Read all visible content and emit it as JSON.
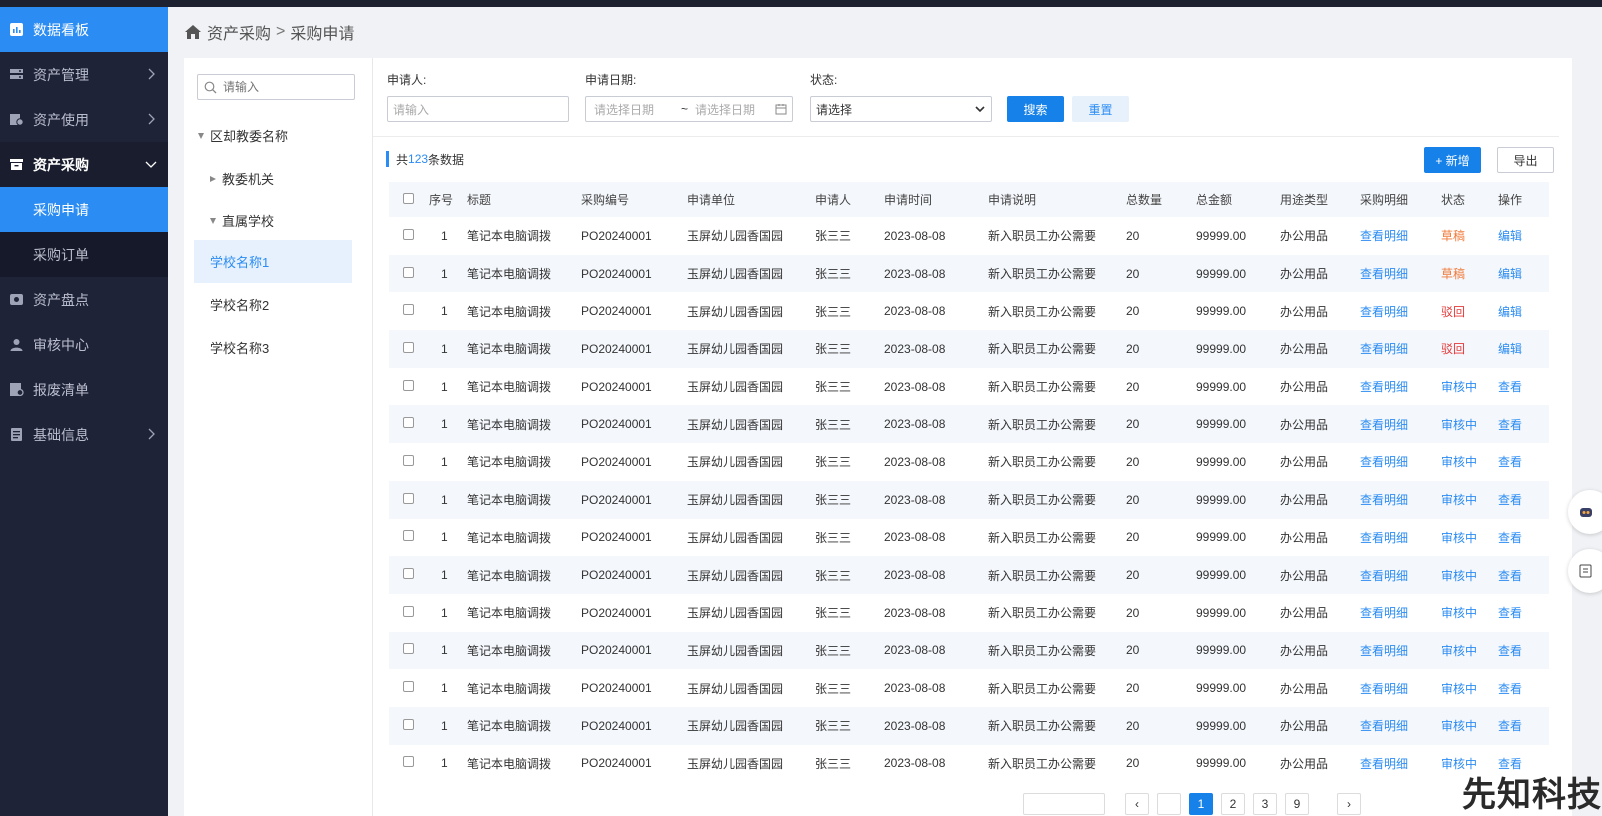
{
  "sidebar": {
    "items": [
      {
        "label": "数据看板",
        "icon": "chart-icon"
      },
      {
        "label": "资产管理",
        "icon": "server-icon"
      },
      {
        "label": "资产使用",
        "icon": "usage-icon"
      },
      {
        "label": "资产采购",
        "icon": "archive-icon"
      },
      {
        "label": "采购申请"
      },
      {
        "label": "采购订单"
      },
      {
        "label": "资产盘点",
        "icon": "inventory-icon"
      },
      {
        "label": "审核中心",
        "icon": "user-icon"
      },
      {
        "label": "报废清单",
        "icon": "scrap-icon"
      },
      {
        "label": "基础信息",
        "icon": "doc-icon"
      }
    ]
  },
  "breadcrumb": {
    "parent": "资产采购",
    "separator": ">",
    "current": "采购申请"
  },
  "tree": {
    "search_placeholder": "请输入",
    "root": "区却教委名称",
    "children": [
      "教委机关",
      "直属学校"
    ],
    "schools": [
      "学校名称1",
      "学校名称2",
      "学校名称3"
    ]
  },
  "filters": {
    "applicant_label": "申请人:",
    "applicant_placeholder": "请输入",
    "date_label": "申请日期:",
    "date_start_placeholder": "请选择日期",
    "date_sep": "~",
    "date_end_placeholder": "请选择日期",
    "status_label": "状态:",
    "status_value": "请选择",
    "search_button": "搜索",
    "reset_button": "重置"
  },
  "summary": {
    "prefix": "共",
    "count": "123",
    "suffix": "条数据"
  },
  "actions": {
    "add_button": "+ 新增",
    "export_button": "导出"
  },
  "table": {
    "columns": [
      "序号",
      "标题",
      "采购编号",
      "申请单位",
      "申请人",
      "申请时间",
      "申请说明",
      "总数量",
      "总金额",
      "用途类型",
      "采购明细",
      "状态",
      "操作"
    ],
    "rows": [
      {
        "no": "1",
        "title": "笔记本电脑调拨",
        "code": "PO20240001",
        "unit": "玉屏幼儿园香国园",
        "applicant": "张三三",
        "time": "2023-08-08",
        "desc": "新入职员工办公需要",
        "qty": "20",
        "amount": "99999.00",
        "usage": "办公用品",
        "detail": "查看明细",
        "status": "草稿",
        "status_type": "draft",
        "op": "编辑"
      },
      {
        "no": "1",
        "title": "笔记本电脑调拨",
        "code": "PO20240001",
        "unit": "玉屏幼儿园香国园",
        "applicant": "张三三",
        "time": "2023-08-08",
        "desc": "新入职员工办公需要",
        "qty": "20",
        "amount": "99999.00",
        "usage": "办公用品",
        "detail": "查看明细",
        "status": "草稿",
        "status_type": "draft",
        "op": "编辑"
      },
      {
        "no": "1",
        "title": "笔记本电脑调拨",
        "code": "PO20240001",
        "unit": "玉屏幼儿园香国园",
        "applicant": "张三三",
        "time": "2023-08-08",
        "desc": "新入职员工办公需要",
        "qty": "20",
        "amount": "99999.00",
        "usage": "办公用品",
        "detail": "查看明细",
        "status": "驳回",
        "status_type": "reject",
        "op": "编辑"
      },
      {
        "no": "1",
        "title": "笔记本电脑调拨",
        "code": "PO20240001",
        "unit": "玉屏幼儿园香国园",
        "applicant": "张三三",
        "time": "2023-08-08",
        "desc": "新入职员工办公需要",
        "qty": "20",
        "amount": "99999.00",
        "usage": "办公用品",
        "detail": "查看明细",
        "status": "驳回",
        "status_type": "reject",
        "op": "编辑"
      },
      {
        "no": "1",
        "title": "笔记本电脑调拨",
        "code": "PO20240001",
        "unit": "玉屏幼儿园香国园",
        "applicant": "张三三",
        "time": "2023-08-08",
        "desc": "新入职员工办公需要",
        "qty": "20",
        "amount": "99999.00",
        "usage": "办公用品",
        "detail": "查看明细",
        "status": "审核中",
        "status_type": "review",
        "op": "查看"
      },
      {
        "no": "1",
        "title": "笔记本电脑调拨",
        "code": "PO20240001",
        "unit": "玉屏幼儿园香国园",
        "applicant": "张三三",
        "time": "2023-08-08",
        "desc": "新入职员工办公需要",
        "qty": "20",
        "amount": "99999.00",
        "usage": "办公用品",
        "detail": "查看明细",
        "status": "审核中",
        "status_type": "review",
        "op": "查看"
      },
      {
        "no": "1",
        "title": "笔记本电脑调拨",
        "code": "PO20240001",
        "unit": "玉屏幼儿园香国园",
        "applicant": "张三三",
        "time": "2023-08-08",
        "desc": "新入职员工办公需要",
        "qty": "20",
        "amount": "99999.00",
        "usage": "办公用品",
        "detail": "查看明细",
        "status": "审核中",
        "status_type": "review",
        "op": "查看"
      },
      {
        "no": "1",
        "title": "笔记本电脑调拨",
        "code": "PO20240001",
        "unit": "玉屏幼儿园香国园",
        "applicant": "张三三",
        "time": "2023-08-08",
        "desc": "新入职员工办公需要",
        "qty": "20",
        "amount": "99999.00",
        "usage": "办公用品",
        "detail": "查看明细",
        "status": "审核中",
        "status_type": "review",
        "op": "查看"
      },
      {
        "no": "1",
        "title": "笔记本电脑调拨",
        "code": "PO20240001",
        "unit": "玉屏幼儿园香国园",
        "applicant": "张三三",
        "time": "2023-08-08",
        "desc": "新入职员工办公需要",
        "qty": "20",
        "amount": "99999.00",
        "usage": "办公用品",
        "detail": "查看明细",
        "status": "审核中",
        "status_type": "review",
        "op": "查看"
      },
      {
        "no": "1",
        "title": "笔记本电脑调拨",
        "code": "PO20240001",
        "unit": "玉屏幼儿园香国园",
        "applicant": "张三三",
        "time": "2023-08-08",
        "desc": "新入职员工办公需要",
        "qty": "20",
        "amount": "99999.00",
        "usage": "办公用品",
        "detail": "查看明细",
        "status": "审核中",
        "status_type": "review",
        "op": "查看"
      },
      {
        "no": "1",
        "title": "笔记本电脑调拨",
        "code": "PO20240001",
        "unit": "玉屏幼儿园香国园",
        "applicant": "张三三",
        "time": "2023-08-08",
        "desc": "新入职员工办公需要",
        "qty": "20",
        "amount": "99999.00",
        "usage": "办公用品",
        "detail": "查看明细",
        "status": "审核中",
        "status_type": "review",
        "op": "查看"
      },
      {
        "no": "1",
        "title": "笔记本电脑调拨",
        "code": "PO20240001",
        "unit": "玉屏幼儿园香国园",
        "applicant": "张三三",
        "time": "2023-08-08",
        "desc": "新入职员工办公需要",
        "qty": "20",
        "amount": "99999.00",
        "usage": "办公用品",
        "detail": "查看明细",
        "status": "审核中",
        "status_type": "review",
        "op": "查看"
      },
      {
        "no": "1",
        "title": "笔记本电脑调拨",
        "code": "PO20240001",
        "unit": "玉屏幼儿园香国园",
        "applicant": "张三三",
        "time": "2023-08-08",
        "desc": "新入职员工办公需要",
        "qty": "20",
        "amount": "99999.00",
        "usage": "办公用品",
        "detail": "查看明细",
        "status": "审核中",
        "status_type": "review",
        "op": "查看"
      },
      {
        "no": "1",
        "title": "笔记本电脑调拨",
        "code": "PO20240001",
        "unit": "玉屏幼儿园香国园",
        "applicant": "张三三",
        "time": "2023-08-08",
        "desc": "新入职员工办公需要",
        "qty": "20",
        "amount": "99999.00",
        "usage": "办公用品",
        "detail": "查看明细",
        "status": "审核中",
        "status_type": "review",
        "op": "查看"
      },
      {
        "no": "1",
        "title": "笔记本电脑调拨",
        "code": "PO20240001",
        "unit": "玉屏幼儿园香国园",
        "applicant": "张三三",
        "time": "2023-08-08",
        "desc": "新入职员工办公需要",
        "qty": "20",
        "amount": "99999.00",
        "usage": "办公用品",
        "detail": "查看明细",
        "status": "审核中",
        "status_type": "review",
        "op": "查看"
      }
    ]
  },
  "pagination": {
    "pages": [
      "1",
      "2",
      "3",
      "9"
    ]
  },
  "watermark": "先知科技",
  "colors": {
    "primary": "#2b8cf3",
    "sidebar": "#1f2338",
    "draft": "#f07a3a",
    "reject": "#e43a3a"
  }
}
